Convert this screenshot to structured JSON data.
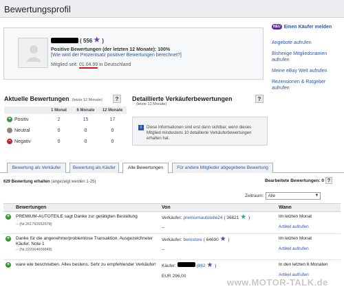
{
  "page_title": "Bewertungsprofil",
  "profile": {
    "score": "( 556",
    "score_close": ")",
    "positive": "Positive Bewertungen (der letzten 12 Monate): 100%",
    "percent_link": "[Wie wird der Prozentsatz positiver Bewertungen berechnet?]",
    "member_prefix": "Mitglied seit:",
    "member_date": "01.04.99",
    "member_suffix": "in Deutschland"
  },
  "sidebar": {
    "badge": "NEU",
    "report": "Einen Käufer melden",
    "links": [
      "Angebote aufrufen",
      "Bisherige Mitgliedsnamen aufrufen",
      "Meine eBay Welt aufrufen",
      "Rezensionen & Ratgeber aufrufen"
    ]
  },
  "current": {
    "title": "Aktuelle Bewertungen",
    "sub": "(letzte 12 Monate)",
    "help": "?",
    "cols": [
      "1 Monat",
      "6 Monate",
      "12 Monate"
    ],
    "rows": [
      {
        "label": "Positiv",
        "vals": [
          "2",
          "15",
          "17"
        ],
        "link": true
      },
      {
        "label": "Neutral",
        "vals": [
          "0",
          "0",
          "0"
        ],
        "link": false
      },
      {
        "label": "Negativ",
        "vals": [
          "0",
          "0",
          "0"
        ],
        "link": false
      }
    ]
  },
  "detailed": {
    "title": "Detaillierte Verkäuferbewertungen",
    "sub": "(letzte 12 Monate)",
    "help": "?",
    "info": "Diese Informationen sind erst dann sichtbar, wenn dieses Mitglied mindestens 10 detaillierte Verkäuferbewertungen erhalten hat."
  },
  "tabs": [
    "Bewertung als Verkäufer",
    "Bewertung als Käufer",
    "Alle Bewertungen",
    "Für andere Mitglieder abgegebene Bewertung"
  ],
  "count": {
    "bold": "629 Bewertung erhalten",
    "rest": "(angezeigt werden 1-25)"
  },
  "edited": {
    "label": "Bearbeitete Bewertungen: 0",
    "help": "?"
  },
  "period": {
    "label": "Zeitraum:",
    "value": "Alle"
  },
  "feedback": {
    "headers": [
      "Bewertungen",
      "Von",
      "Wann"
    ],
    "rows": [
      {
        "text": "PREMIUM-AUTOTEILE sagt Danke zur getätigten Bestellung",
        "num": "-- (Nr.261792652678)",
        "role": "Verkäufer:",
        "user": "premiumautoteile24",
        "score": "( 36821",
        "dash": "--",
        "when": "Im letzten Monat",
        "action": "Artikel aufrufen"
      },
      {
        "text": "Danke für die angenehme/problemlose Transaktion. Ausgezeichneter Käufer. Note 1",
        "num": "-- (Nr.322064609848)",
        "role": "Verkäufer:",
        "user": "berostore",
        "score": "( 64690",
        "dash": "--",
        "when": "Im letzten Monat",
        "action": "Artikel aufrufen"
      },
      {
        "text": "ware wie beschrieben. Alles bestens. Sehr zu empfehlender Verkäufer!",
        "role": "Käufer:",
        "score": "862",
        "price": "EUR 296,00",
        "when": "In den letzten 6 Monaten",
        "action": "Artikel aufrufen"
      }
    ]
  },
  "watermark": "www.MOTOR-TALK.de"
}
